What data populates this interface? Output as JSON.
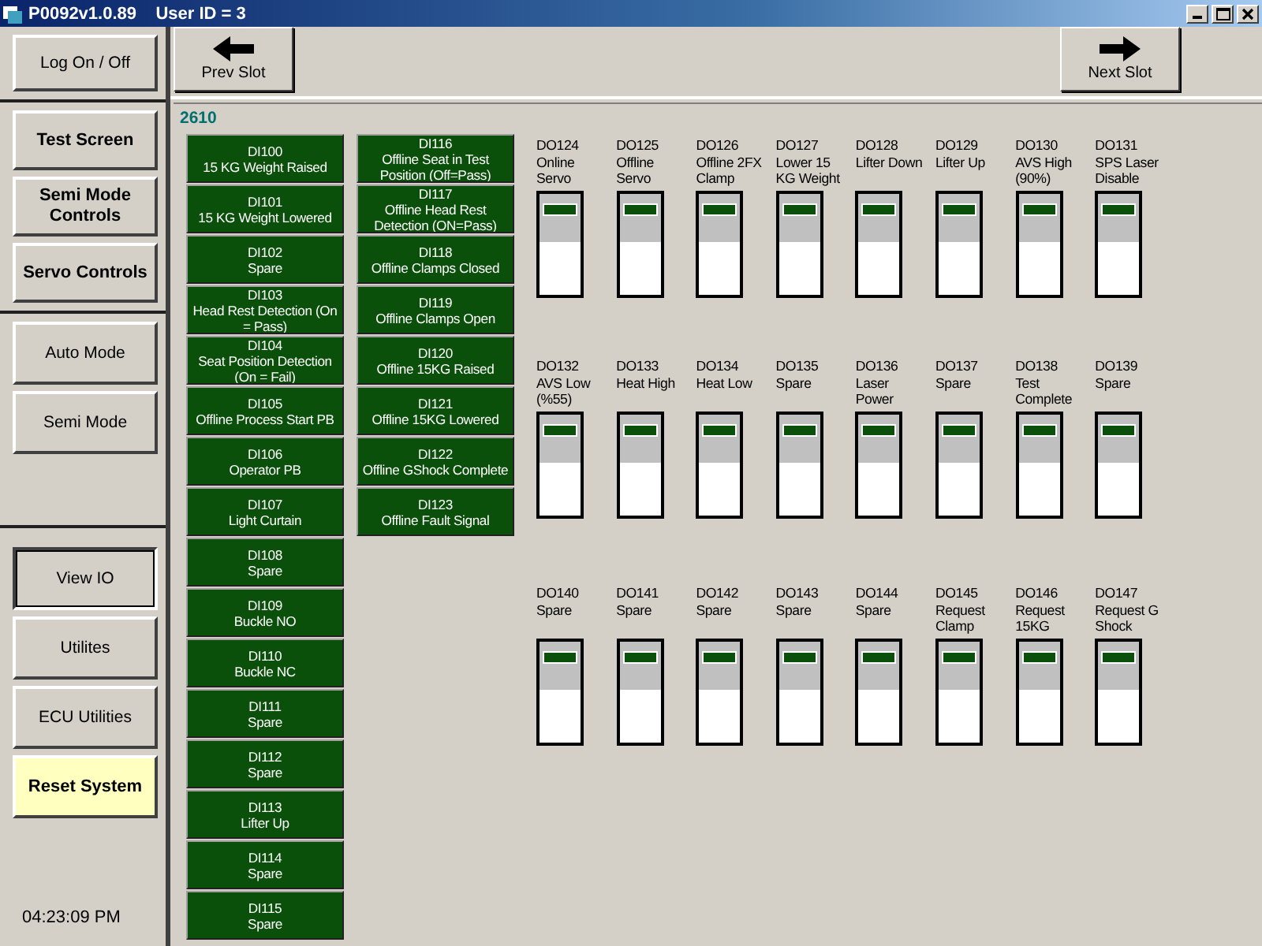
{
  "window": {
    "title": "P0092v1.0.89    User ID = 3"
  },
  "sidebar": {
    "groups": [
      {
        "kind": "plain",
        "buttons": [
          {
            "label": "Log On / Off",
            "selected": false,
            "highlighted": false
          }
        ]
      },
      {
        "kind": "section",
        "buttons": [
          {
            "label": "Test Screen",
            "selected": false,
            "highlighted": false
          },
          {
            "label": "Semi Mode Controls",
            "selected": false,
            "highlighted": false
          },
          {
            "label": "Servo Controls",
            "selected": false,
            "highlighted": false
          }
        ]
      },
      {
        "kind": "plain",
        "buttons": [
          {
            "label": "Auto Mode",
            "selected": false,
            "highlighted": false
          },
          {
            "label": "Semi Mode",
            "selected": false,
            "highlighted": false
          }
        ]
      },
      {
        "kind": "plain",
        "buttons": [
          {
            "label": "View IO",
            "selected": true,
            "highlighted": false
          },
          {
            "label": "Utilites",
            "selected": false,
            "highlighted": false
          },
          {
            "label": "ECU Utilities",
            "selected": false,
            "highlighted": false
          },
          {
            "label": "Reset System",
            "selected": false,
            "highlighted": true
          }
        ]
      }
    ],
    "clock": "04:23:09 PM"
  },
  "toolbar": {
    "prev": "Prev Slot",
    "next": "Next Slot"
  },
  "slot": "2610",
  "inputs": [
    [
      {
        "name": "DI100",
        "label": "15 KG Weight Raised"
      },
      {
        "name": "DI101",
        "label": "15 KG Weight Lowered"
      },
      {
        "name": "DI102",
        "label": "Spare"
      },
      {
        "name": "DI103",
        "label": "Head Rest Detection (On = Pass)"
      },
      {
        "name": "DI104",
        "label": "Seat Position Detection (On = Fail)"
      },
      {
        "name": "DI105",
        "label": "Offline Process Start PB"
      },
      {
        "name": "DI106",
        "label": "Operator PB"
      },
      {
        "name": "DI107",
        "label": "Light Curtain"
      },
      {
        "name": "DI108",
        "label": "Spare"
      },
      {
        "name": "DI109",
        "label": "Buckle NO"
      },
      {
        "name": "DI110",
        "label": "Buckle NC"
      },
      {
        "name": "DI111",
        "label": "Spare"
      },
      {
        "name": "DI112",
        "label": "Spare"
      },
      {
        "name": "DI113",
        "label": "Lifter Up"
      },
      {
        "name": "DI114",
        "label": "Spare"
      },
      {
        "name": "DI115",
        "label": "Spare"
      }
    ],
    [
      {
        "name": "DI116",
        "label": "Offline Seat in Test Position (Off=Pass)"
      },
      {
        "name": "DI117",
        "label": "Offline Head Rest Detection (ON=Pass)"
      },
      {
        "name": "DI118",
        "label": "Offline Clamps Closed"
      },
      {
        "name": "DI119",
        "label": "Offline Clamps Open"
      },
      {
        "name": "DI120",
        "label": "Offline 15KG Raised"
      },
      {
        "name": "DI121",
        "label": "Offline 15KG Lowered"
      },
      {
        "name": "DI122",
        "label": "Offline GShock Complete"
      },
      {
        "name": "DI123",
        "label": "Offline Fault Signal"
      }
    ]
  ],
  "outputs": [
    [
      {
        "name": "DO124",
        "label": "Online Servo",
        "on": false
      },
      {
        "name": "DO125",
        "label": "Offline Servo",
        "on": false
      },
      {
        "name": "DO126",
        "label": "Offline 2FX Clamp",
        "on": false
      },
      {
        "name": "DO127",
        "label": "Lower 15 KG Weight",
        "on": false
      },
      {
        "name": "DO128",
        "label": "Lifter Down",
        "on": false
      },
      {
        "name": "DO129",
        "label": "Lifter Up",
        "on": false
      },
      {
        "name": "DO130",
        "label": "AVS High (90%)",
        "on": false
      },
      {
        "name": "DO131",
        "label": "SPS Laser Disable",
        "on": false
      }
    ],
    [
      {
        "name": "DO132",
        "label": "AVS Low (%55)",
        "on": false
      },
      {
        "name": "DO133",
        "label": "Heat High",
        "on": false
      },
      {
        "name": "DO134",
        "label": "Heat Low",
        "on": false
      },
      {
        "name": "DO135",
        "label": "Spare",
        "on": false
      },
      {
        "name": "DO136",
        "label": "Laser Power",
        "on": false
      },
      {
        "name": "DO137",
        "label": "Spare",
        "on": false
      },
      {
        "name": "DO138",
        "label": "Test Complete",
        "on": false
      },
      {
        "name": "DO139",
        "label": "Spare",
        "on": false
      }
    ],
    [
      {
        "name": "DO140",
        "label": "Spare",
        "on": false
      },
      {
        "name": "DO141",
        "label": "Spare",
        "on": false
      },
      {
        "name": "DO142",
        "label": "Spare",
        "on": false
      },
      {
        "name": "DO143",
        "label": "Spare",
        "on": false
      },
      {
        "name": "DO144",
        "label": "Spare",
        "on": false
      },
      {
        "name": "DO145",
        "label": "Request Clamp",
        "on": false
      },
      {
        "name": "DO146",
        "label": "Request 15KG",
        "on": false
      },
      {
        "name": "DO147",
        "label": "Request G Shock",
        "on": false
      }
    ]
  ]
}
